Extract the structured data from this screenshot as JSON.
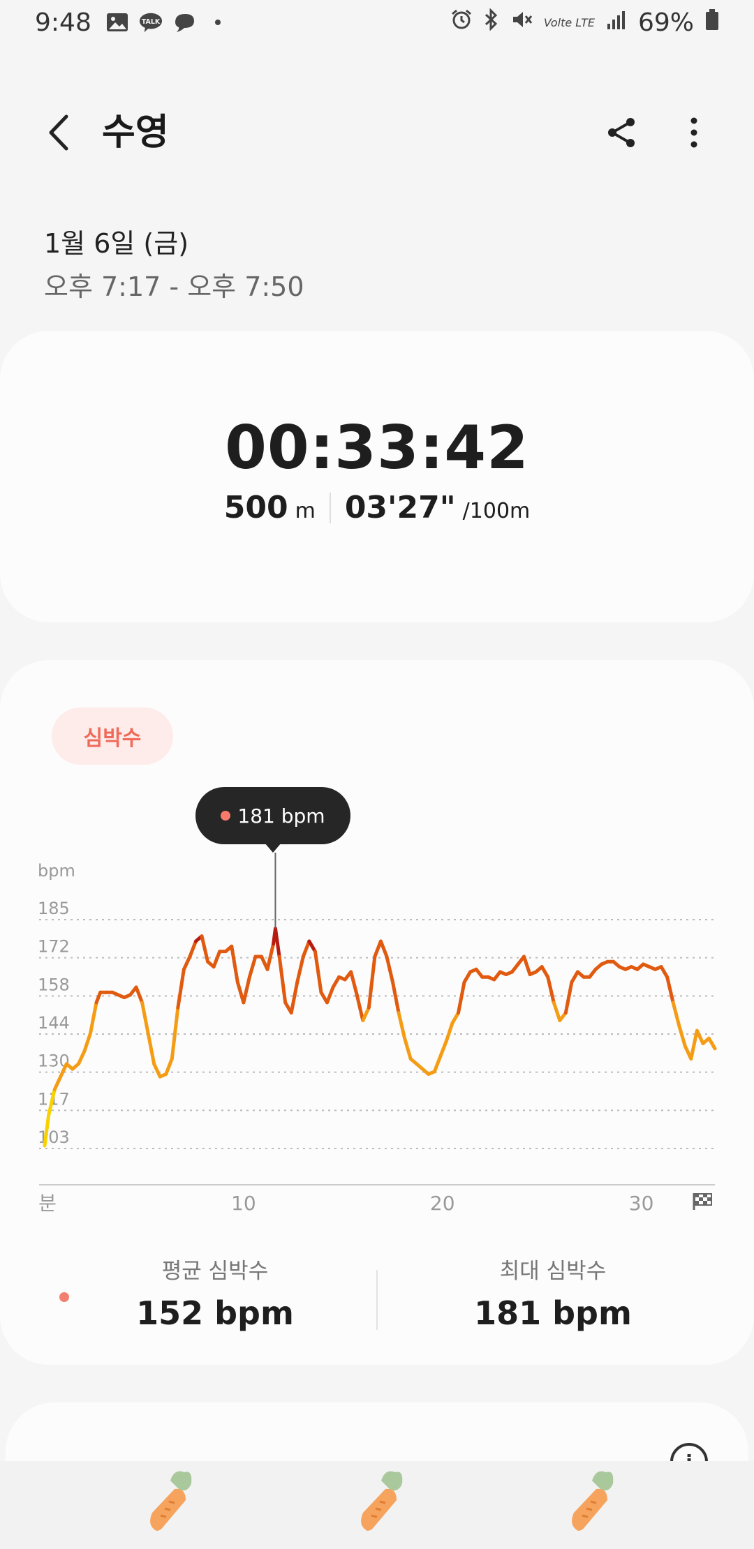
{
  "status_bar": {
    "time": "9:48",
    "signal_text": "Volte LTE",
    "battery": "69%"
  },
  "header": {
    "title": "수영"
  },
  "session": {
    "date": "1월 6일 (금)",
    "time_range": "오후 7:17 - 오후 7:50"
  },
  "summary": {
    "duration": "00:33:42",
    "distance": "500",
    "distance_unit": "m",
    "pace": "03'27\"",
    "pace_unit": "/100m"
  },
  "heart_rate": {
    "chip_label": "심박수",
    "tooltip": "181 bpm",
    "avg_label": "평균 심박수",
    "avg_value": "152 bpm",
    "max_label": "최대 심박수",
    "max_value": "181 bpm"
  },
  "chart_data": {
    "type": "line",
    "title": "",
    "xlabel": "분",
    "ylabel": "bpm",
    "y_ticks": [
      "103",
      "117",
      "130",
      "144",
      "158",
      "172",
      "185"
    ],
    "x_ticks": [
      {
        "value": 10,
        "label": "10"
      },
      {
        "value": 20,
        "label": "20"
      },
      {
        "value": 30,
        "label": "30"
      }
    ],
    "xlim": [
      0,
      33.7
    ],
    "ylim": [
      96,
      185
    ],
    "grid": true,
    "highlight": {
      "x": 11.6,
      "y": 181,
      "label": "181 bpm"
    },
    "colors": {
      "low": "#f7d200",
      "mid": "#f59c15",
      "high": "#e05a10",
      "peak": "#b71c10"
    },
    "series": [
      {
        "x": [
          0.0,
          0.2,
          0.5,
          0.8,
          1.1,
          1.4,
          1.7,
          2.0,
          2.3,
          2.6,
          2.8,
          3.1,
          3.4,
          3.7,
          4.0,
          4.3,
          4.6,
          4.9,
          5.2,
          5.5,
          5.8,
          6.1,
          6.4,
          6.7,
          7.0,
          7.3,
          7.6,
          7.9,
          8.2,
          8.5,
          8.8,
          9.1,
          9.4,
          9.7,
          10.0,
          10.3,
          10.6,
          10.9,
          11.2,
          11.5,
          11.6,
          11.8,
          12.1,
          12.4,
          12.7,
          13.0,
          13.3,
          13.6,
          13.9,
          14.2,
          14.5,
          14.8,
          15.1,
          15.4,
          15.7,
          16.0,
          16.3,
          16.6,
          16.9,
          17.2,
          17.5,
          17.8,
          18.1,
          18.4,
          18.7,
          19.0,
          19.3,
          19.6,
          19.9,
          20.2,
          20.5,
          20.8,
          21.1,
          21.4,
          21.7,
          22.0,
          22.3,
          22.6,
          22.9,
          23.2,
          23.5,
          23.8,
          24.1,
          24.4,
          24.7,
          25.0,
          25.3,
          25.6,
          25.9,
          26.2,
          26.5,
          26.8,
          27.1,
          27.4,
          27.7,
          28.0,
          28.3,
          28.6,
          28.9,
          29.2,
          29.5,
          29.8,
          30.1,
          30.4,
          30.7,
          31.0,
          31.3,
          31.6,
          31.9,
          32.2,
          32.5,
          32.8,
          33.1,
          33.4,
          33.7
        ],
        "y": [
          96,
          108,
          118,
          123,
          128,
          126,
          128,
          133,
          140,
          152,
          156,
          156,
          156,
          155,
          154,
          155,
          158,
          152,
          140,
          128,
          123,
          124,
          130,
          150,
          165,
          170,
          176,
          178,
          168,
          166,
          172,
          172,
          174,
          160,
          152,
          162,
          170,
          170,
          165,
          175,
          181,
          170,
          152,
          148,
          160,
          170,
          176,
          172,
          156,
          152,
          158,
          162,
          161,
          164,
          155,
          145,
          150,
          170,
          176,
          170,
          160,
          148,
          138,
          130,
          128,
          126,
          124,
          125,
          131,
          137,
          144,
          148,
          160,
          164,
          165,
          162,
          162,
          161,
          164,
          163,
          164,
          167,
          170,
          163,
          164,
          166,
          162,
          152,
          145,
          148,
          160,
          164,
          162,
          162,
          165,
          167,
          168,
          168,
          166,
          165,
          166,
          165,
          167,
          166,
          165,
          166,
          162,
          152,
          143,
          135,
          130,
          141,
          136,
          138,
          134
        ]
      }
    ]
  }
}
